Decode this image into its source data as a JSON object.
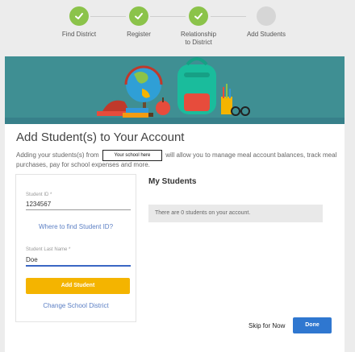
{
  "steps": [
    {
      "label": "Find District",
      "state": "done"
    },
    {
      "label": "Register",
      "state": "done"
    },
    {
      "label": "Relationship to District",
      "state": "done"
    },
    {
      "label": "Add Students",
      "state": "current"
    }
  ],
  "page": {
    "title": "Add Student(s) to Your Account",
    "desc_before": "Adding your students(s) from",
    "school_name": "Your school here",
    "desc_after": "will allow you to manage meal account balances, track meal purchases, pay for school expenses and more."
  },
  "form": {
    "student_id_label": "Student ID *",
    "student_id_value": "1234567",
    "where_link": "Where to find Student ID?",
    "last_name_label": "Student Last Name *",
    "last_name_value": "Doe",
    "add_button": "Add Student",
    "change_link": "Change School District"
  },
  "my_students": {
    "title": "My Students",
    "empty_text": "There are 0 students on your account."
  },
  "footer": {
    "skip_label": "Skip for Now",
    "done_label": "Done"
  },
  "colors": {
    "step_done": "#8bc34a",
    "step_todo": "#d6d6d6",
    "banner": "#3f8f93",
    "add_button": "#f4b400",
    "done_button": "#2f77d0"
  }
}
